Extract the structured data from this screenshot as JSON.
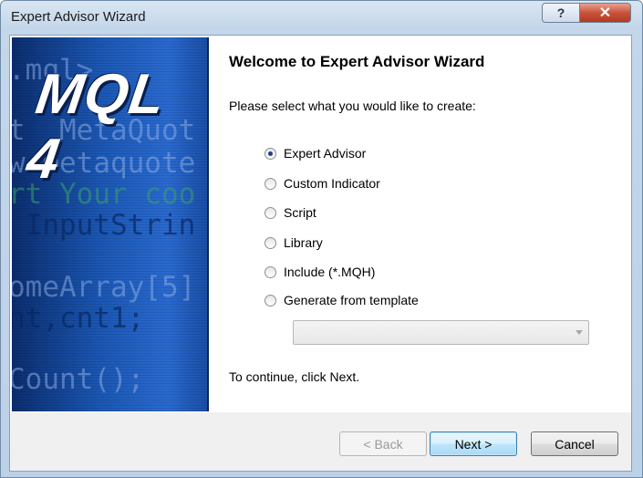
{
  "window": {
    "title": "Expert Advisor Wizard",
    "help_label": "?",
    "close_label": "✕"
  },
  "banner": {
    "logo": "MQL 4",
    "code_lines": [
      ".mql>",
      "t  MetaQuot",
      "w.metaquote",
      "rt Your coo",
      " InputStrin",
      "omeArray[5]",
      "nt,cnt1;",
      "Count();"
    ]
  },
  "content": {
    "heading": "Welcome to Expert Advisor Wizard",
    "prompt": "Please select what you would like to create:",
    "options": [
      {
        "label": "Expert Advisor",
        "checked": true
      },
      {
        "label": "Custom Indicator",
        "checked": false
      },
      {
        "label": "Script",
        "checked": false
      },
      {
        "label": "Library",
        "checked": false
      },
      {
        "label": "Include (*.MQH)",
        "checked": false
      },
      {
        "label": "Generate from template",
        "checked": false
      }
    ],
    "template_select_value": "",
    "continue_text": "To continue, click Next."
  },
  "buttons": {
    "back": "< Back",
    "next": "Next >",
    "cancel": "Cancel"
  }
}
